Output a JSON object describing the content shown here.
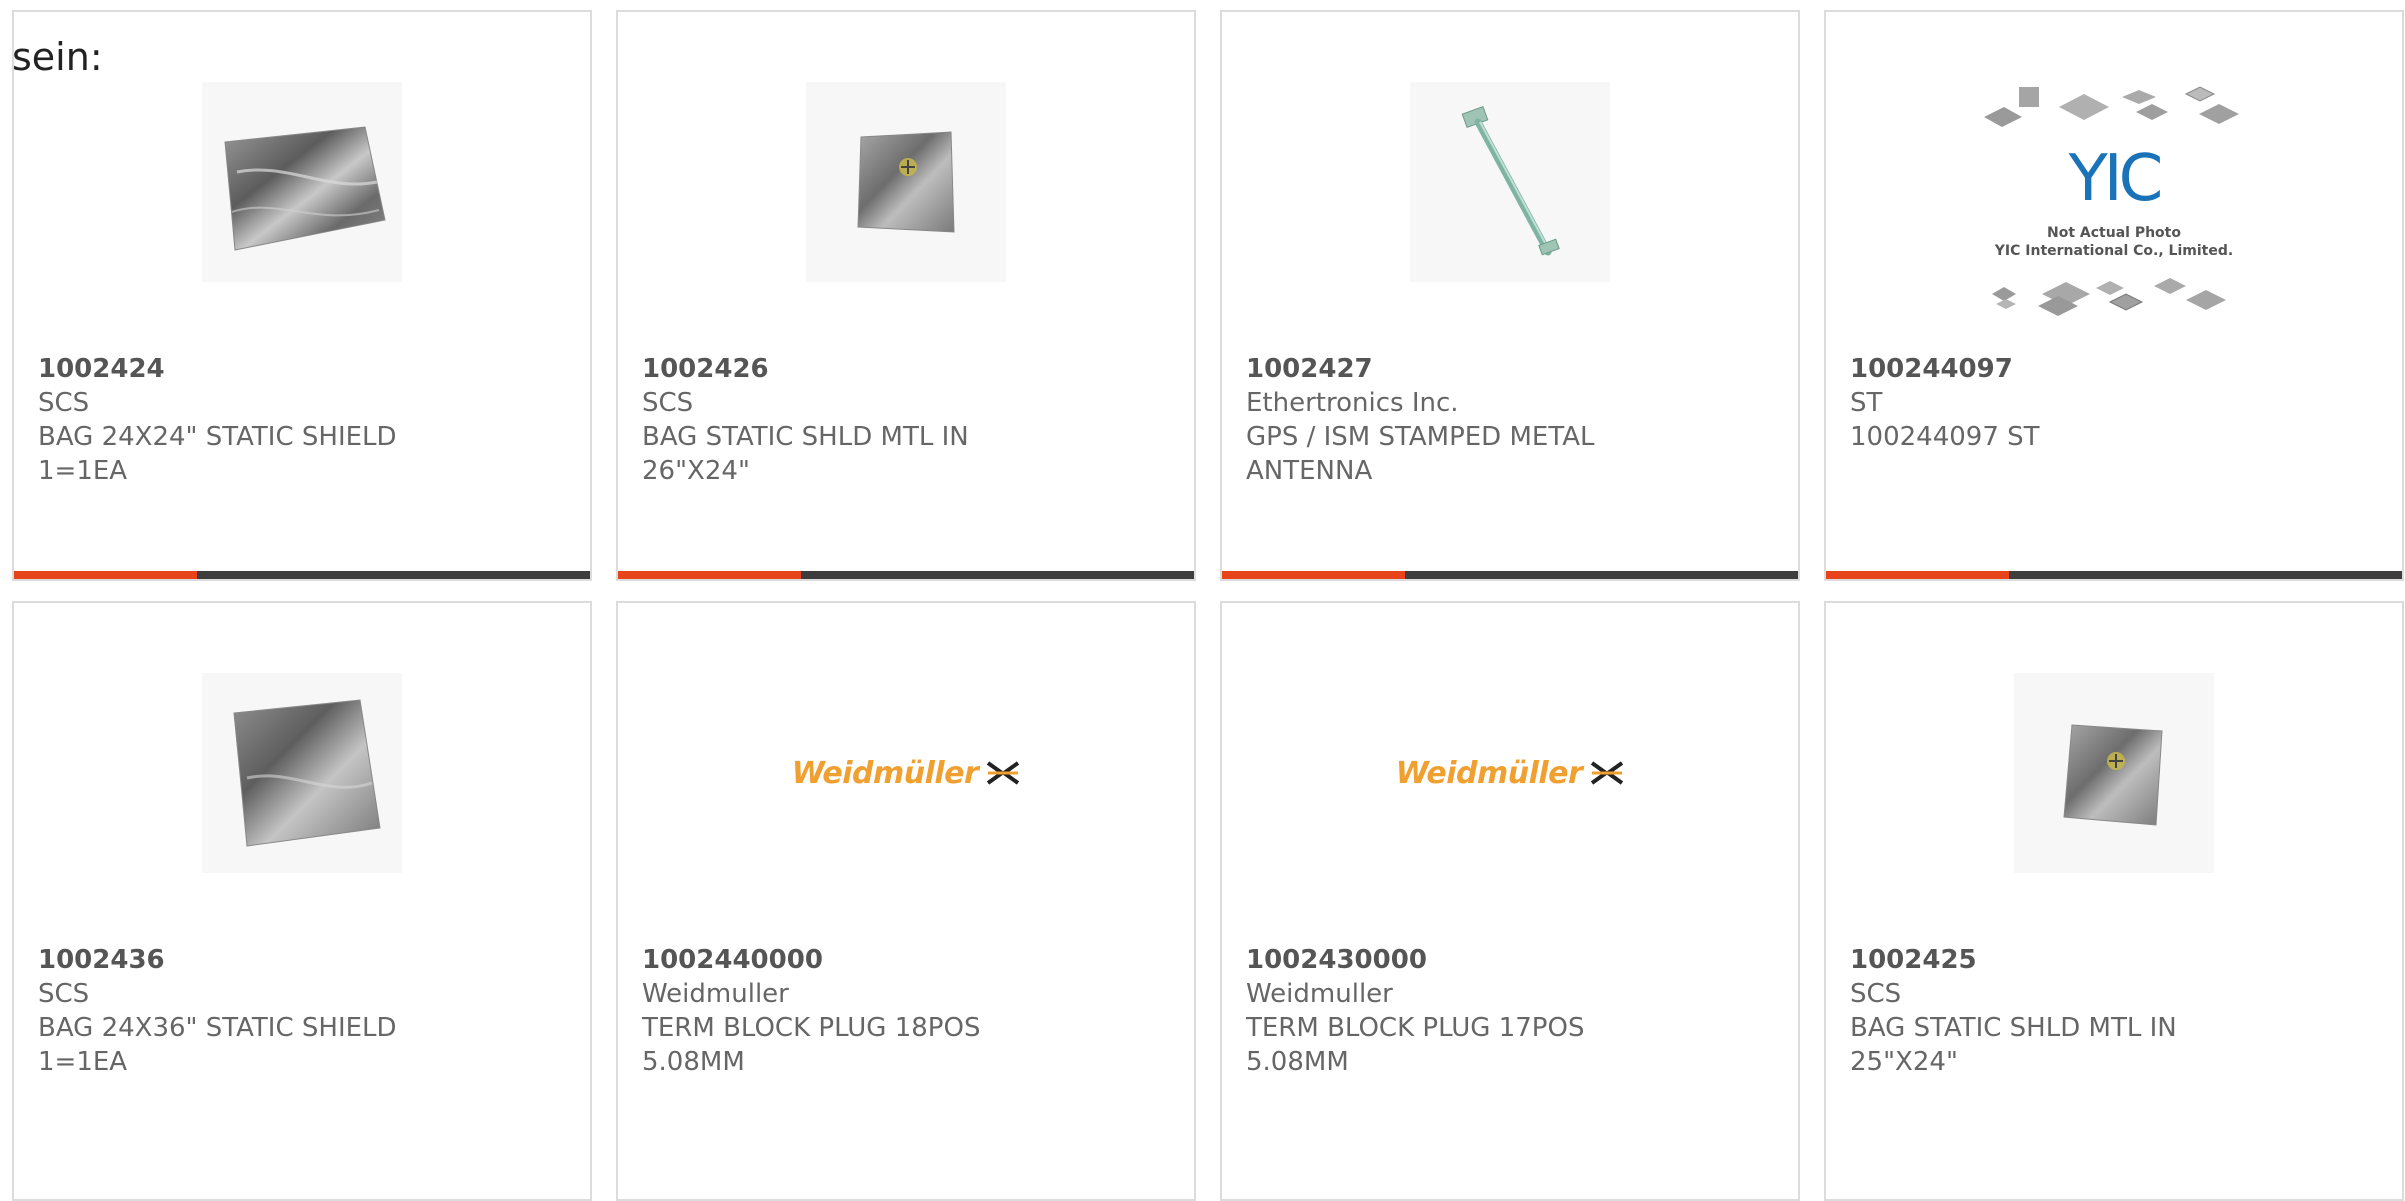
{
  "header": {
    "label": "sein:"
  },
  "colors": {
    "accent": "#e8441b",
    "bar": "#3d3d3d",
    "weidmuller_orange": "#f0a030"
  },
  "products": [
    {
      "part_number": "1002424",
      "manufacturer": "SCS",
      "description_line1": "BAG 24X24\" STATIC SHIELD",
      "description_line2": "1=1EA",
      "image": "static-shield-bag-icon"
    },
    {
      "part_number": "1002426",
      "manufacturer": "SCS",
      "description_line1": "BAG STATIC SHLD MTL IN",
      "description_line2": "26\"X24\"",
      "image": "static-shield-bag-icon"
    },
    {
      "part_number": "1002427",
      "manufacturer": "Ethertronics Inc.",
      "description_line1": "GPS / ISM STAMPED METAL",
      "description_line2": "ANTENNA",
      "image": "stamped-antenna-icon"
    },
    {
      "part_number": "100244097",
      "manufacturer": "ST",
      "description_line1": "100244097 ST",
      "description_line2": "",
      "image": "yic-placeholder",
      "image_logo_text": "YIC",
      "image_caption_line1": "Not Actual Photo",
      "image_caption_line2": "YIC International Co., Limited."
    },
    {
      "part_number": "1002436",
      "manufacturer": "SCS",
      "description_line1": "BAG 24X36\" STATIC SHIELD",
      "description_line2": "1=1EA",
      "image": "static-shield-bag-icon"
    },
    {
      "part_number": "1002440000",
      "manufacturer": "Weidmuller",
      "description_line1": "TERM BLOCK PLUG 18POS",
      "description_line2": "5.08MM",
      "image": "weidmuller-logo",
      "image_logo_text": "Weidmüller"
    },
    {
      "part_number": "1002430000",
      "manufacturer": "Weidmuller",
      "description_line1": "TERM BLOCK PLUG 17POS",
      "description_line2": "5.08MM",
      "image": "weidmuller-logo",
      "image_logo_text": "Weidmüller"
    },
    {
      "part_number": "1002425",
      "manufacturer": "SCS",
      "description_line1": "BAG STATIC SHLD MTL IN",
      "description_line2": "25\"X24\"",
      "image": "static-shield-bag-icon"
    }
  ]
}
